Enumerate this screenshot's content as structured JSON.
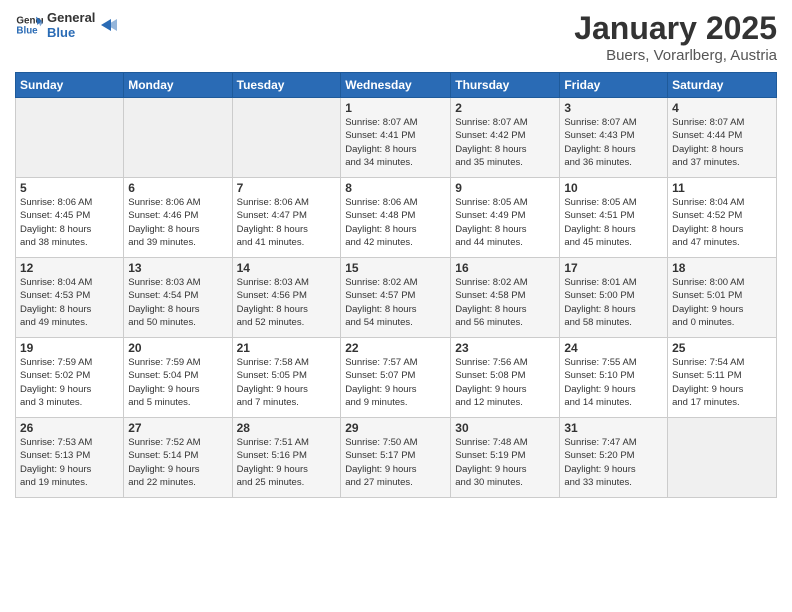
{
  "logo": {
    "line1": "General",
    "line2": "Blue"
  },
  "header": {
    "month": "January 2025",
    "location": "Buers, Vorarlberg, Austria"
  },
  "weekdays": [
    "Sunday",
    "Monday",
    "Tuesday",
    "Wednesday",
    "Thursday",
    "Friday",
    "Saturday"
  ],
  "weeks": [
    [
      {
        "day": "",
        "info": ""
      },
      {
        "day": "",
        "info": ""
      },
      {
        "day": "",
        "info": ""
      },
      {
        "day": "1",
        "info": "Sunrise: 8:07 AM\nSunset: 4:41 PM\nDaylight: 8 hours\nand 34 minutes."
      },
      {
        "day": "2",
        "info": "Sunrise: 8:07 AM\nSunset: 4:42 PM\nDaylight: 8 hours\nand 35 minutes."
      },
      {
        "day": "3",
        "info": "Sunrise: 8:07 AM\nSunset: 4:43 PM\nDaylight: 8 hours\nand 36 minutes."
      },
      {
        "day": "4",
        "info": "Sunrise: 8:07 AM\nSunset: 4:44 PM\nDaylight: 8 hours\nand 37 minutes."
      }
    ],
    [
      {
        "day": "5",
        "info": "Sunrise: 8:06 AM\nSunset: 4:45 PM\nDaylight: 8 hours\nand 38 minutes."
      },
      {
        "day": "6",
        "info": "Sunrise: 8:06 AM\nSunset: 4:46 PM\nDaylight: 8 hours\nand 39 minutes."
      },
      {
        "day": "7",
        "info": "Sunrise: 8:06 AM\nSunset: 4:47 PM\nDaylight: 8 hours\nand 41 minutes."
      },
      {
        "day": "8",
        "info": "Sunrise: 8:06 AM\nSunset: 4:48 PM\nDaylight: 8 hours\nand 42 minutes."
      },
      {
        "day": "9",
        "info": "Sunrise: 8:05 AM\nSunset: 4:49 PM\nDaylight: 8 hours\nand 44 minutes."
      },
      {
        "day": "10",
        "info": "Sunrise: 8:05 AM\nSunset: 4:51 PM\nDaylight: 8 hours\nand 45 minutes."
      },
      {
        "day": "11",
        "info": "Sunrise: 8:04 AM\nSunset: 4:52 PM\nDaylight: 8 hours\nand 47 minutes."
      }
    ],
    [
      {
        "day": "12",
        "info": "Sunrise: 8:04 AM\nSunset: 4:53 PM\nDaylight: 8 hours\nand 49 minutes."
      },
      {
        "day": "13",
        "info": "Sunrise: 8:03 AM\nSunset: 4:54 PM\nDaylight: 8 hours\nand 50 minutes."
      },
      {
        "day": "14",
        "info": "Sunrise: 8:03 AM\nSunset: 4:56 PM\nDaylight: 8 hours\nand 52 minutes."
      },
      {
        "day": "15",
        "info": "Sunrise: 8:02 AM\nSunset: 4:57 PM\nDaylight: 8 hours\nand 54 minutes."
      },
      {
        "day": "16",
        "info": "Sunrise: 8:02 AM\nSunset: 4:58 PM\nDaylight: 8 hours\nand 56 minutes."
      },
      {
        "day": "17",
        "info": "Sunrise: 8:01 AM\nSunset: 5:00 PM\nDaylight: 8 hours\nand 58 minutes."
      },
      {
        "day": "18",
        "info": "Sunrise: 8:00 AM\nSunset: 5:01 PM\nDaylight: 9 hours\nand 0 minutes."
      }
    ],
    [
      {
        "day": "19",
        "info": "Sunrise: 7:59 AM\nSunset: 5:02 PM\nDaylight: 9 hours\nand 3 minutes."
      },
      {
        "day": "20",
        "info": "Sunrise: 7:59 AM\nSunset: 5:04 PM\nDaylight: 9 hours\nand 5 minutes."
      },
      {
        "day": "21",
        "info": "Sunrise: 7:58 AM\nSunset: 5:05 PM\nDaylight: 9 hours\nand 7 minutes."
      },
      {
        "day": "22",
        "info": "Sunrise: 7:57 AM\nSunset: 5:07 PM\nDaylight: 9 hours\nand 9 minutes."
      },
      {
        "day": "23",
        "info": "Sunrise: 7:56 AM\nSunset: 5:08 PM\nDaylight: 9 hours\nand 12 minutes."
      },
      {
        "day": "24",
        "info": "Sunrise: 7:55 AM\nSunset: 5:10 PM\nDaylight: 9 hours\nand 14 minutes."
      },
      {
        "day": "25",
        "info": "Sunrise: 7:54 AM\nSunset: 5:11 PM\nDaylight: 9 hours\nand 17 minutes."
      }
    ],
    [
      {
        "day": "26",
        "info": "Sunrise: 7:53 AM\nSunset: 5:13 PM\nDaylight: 9 hours\nand 19 minutes."
      },
      {
        "day": "27",
        "info": "Sunrise: 7:52 AM\nSunset: 5:14 PM\nDaylight: 9 hours\nand 22 minutes."
      },
      {
        "day": "28",
        "info": "Sunrise: 7:51 AM\nSunset: 5:16 PM\nDaylight: 9 hours\nand 25 minutes."
      },
      {
        "day": "29",
        "info": "Sunrise: 7:50 AM\nSunset: 5:17 PM\nDaylight: 9 hours\nand 27 minutes."
      },
      {
        "day": "30",
        "info": "Sunrise: 7:48 AM\nSunset: 5:19 PM\nDaylight: 9 hours\nand 30 minutes."
      },
      {
        "day": "31",
        "info": "Sunrise: 7:47 AM\nSunset: 5:20 PM\nDaylight: 9 hours\nand 33 minutes."
      },
      {
        "day": "",
        "info": ""
      }
    ]
  ]
}
